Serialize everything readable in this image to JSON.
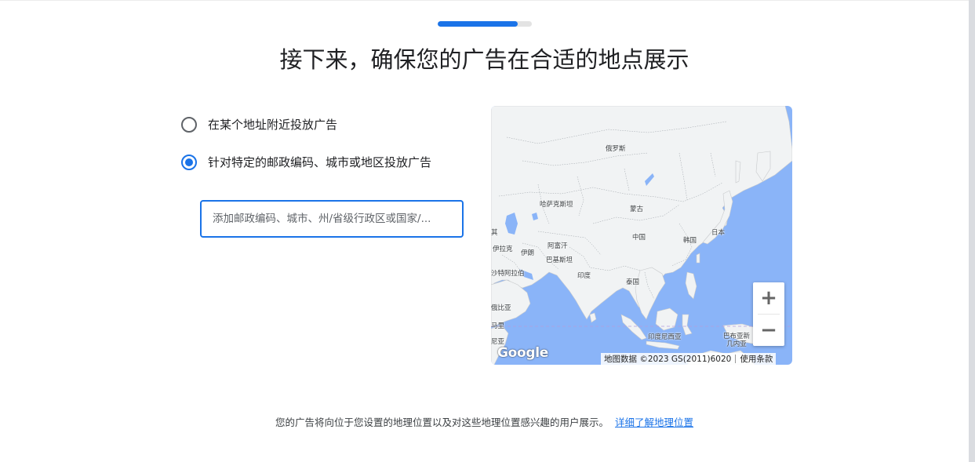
{
  "progress": {
    "fraction": 0.85
  },
  "title": "接下来，确保您的广告在合适的地点展示",
  "options": [
    {
      "label": "在某个地址附近投放广告",
      "checked": false
    },
    {
      "label": "针对特定的邮政编码、城市或地区投放广告",
      "checked": true
    }
  ],
  "location_input": {
    "value": "",
    "placeholder": "添加邮政编码、城市、州/省级行政区或国家/..."
  },
  "map": {
    "labels": [
      "俄罗斯",
      "哈萨克斯坦",
      "蒙古",
      "中国",
      "韩国",
      "日本",
      "阿富汗",
      "伊朗",
      "伊拉克",
      "巴基斯坦",
      "沙特阿拉伯",
      "印度",
      "泰国",
      "印度尼西亚",
      "巴布亚新几内亚",
      "俄比亚",
      "其",
      "马里",
      "尼亚"
    ],
    "zoom_in": "+",
    "zoom_out": "−",
    "logo": "Google",
    "attribution_data": "地图数据 ©2023 GS(2011)6020",
    "terms": "使用条款",
    "colors": {
      "water": "#8ab4f8",
      "land": "#f1f3f4",
      "border": "#9aa0a6"
    }
  },
  "footer": {
    "text": "您的广告将向位于您设置的地理位置以及对这些地理位置感兴趣的用户展示。",
    "link": "详细了解地理位置"
  }
}
